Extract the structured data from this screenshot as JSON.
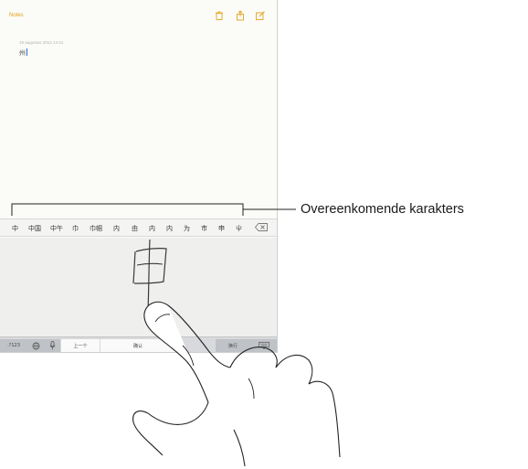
{
  "notes": {
    "back_label": "Notes",
    "date": "19 augustus 2013 14:41",
    "text": "州"
  },
  "candidates": [
    "中",
    "中国",
    "中午",
    "巾",
    "巾帼",
    "内",
    "由",
    "内",
    "内",
    "为",
    "市",
    "申",
    "屮"
  ],
  "keyboard": {
    "numbers_label": ".?123",
    "prev_label": "上一个",
    "confirm_label": "确认",
    "return_label": "换行"
  },
  "callout": {
    "label": "Overeenkomende karakters"
  },
  "colors": {
    "accent": "#e3a21a",
    "ink": "#3a3a3a"
  },
  "icons": [
    "trash-icon",
    "share-icon",
    "compose-icon",
    "delete-icon",
    "globe-icon",
    "microphone-icon",
    "keyboard-hide-icon"
  ]
}
